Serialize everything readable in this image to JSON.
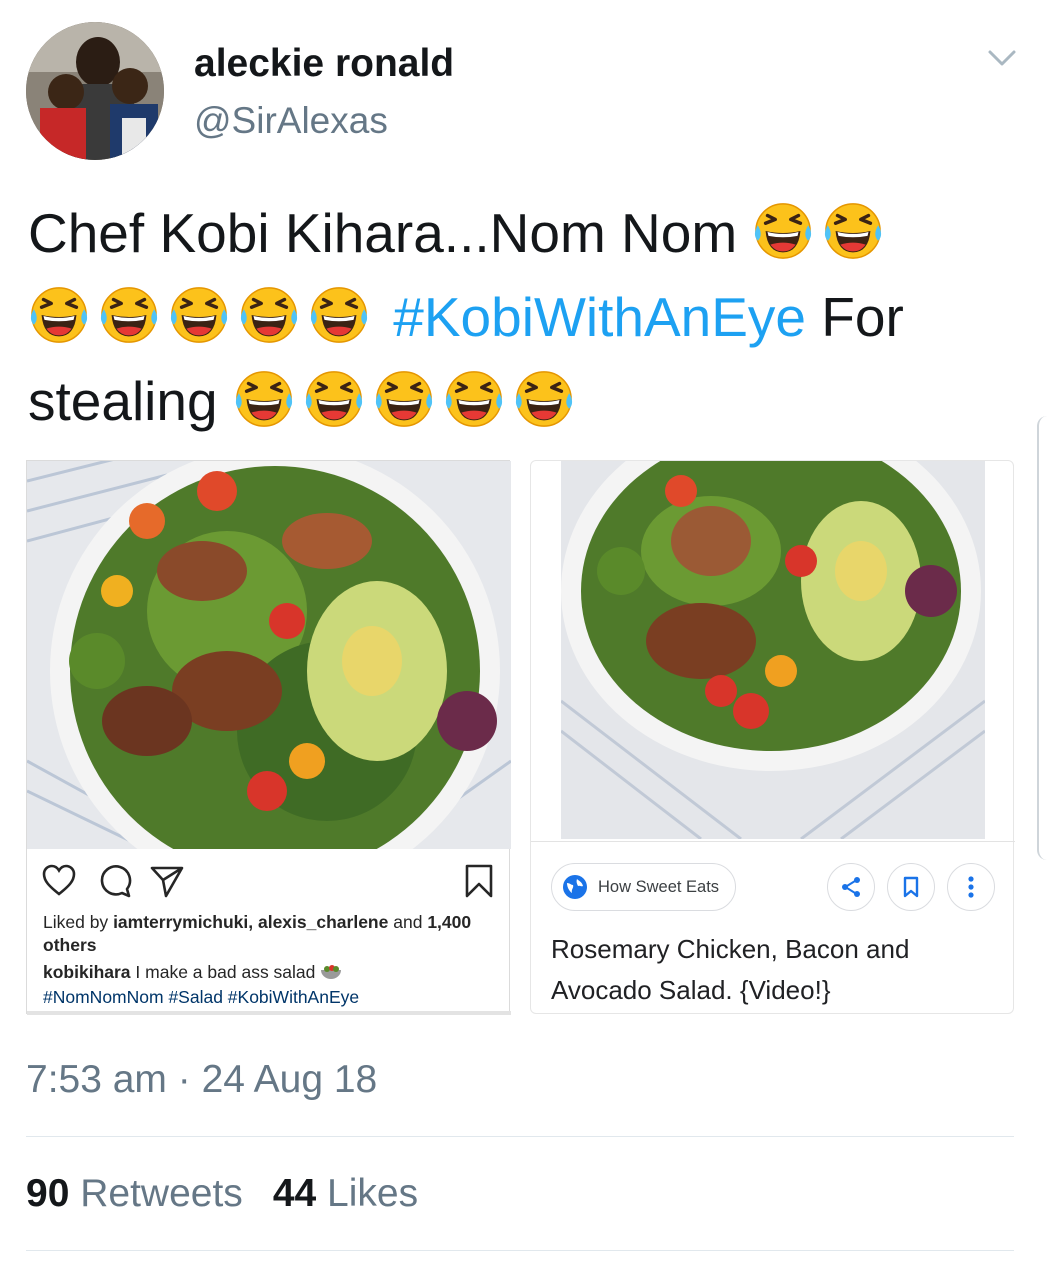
{
  "tweet": {
    "display_name": "aleckie ronald",
    "handle": "@SirAlexas",
    "text_part1": "Chef Kobi Kihara...Nom Nom",
    "hashtag": "#KobiWithAnEye",
    "text_part2": "For",
    "text_part3": "stealing",
    "emoji": "rolling-on-the-floor-laughing-emoji",
    "timestamp": "7:53 am · 24 Aug 18",
    "retweets_count": "90",
    "retweets_label": "Retweets",
    "likes_count": "44",
    "likes_label": "Likes"
  },
  "instagram_card": {
    "liked_by_prefix": "Liked by",
    "liked_by_users": "iamterrymichuki, alexis_charlene",
    "liked_by_and": "and",
    "liked_by_count": "1,400",
    "liked_by_suffix": "others",
    "caption_user": "kobikihara",
    "caption_text": "I make a bad ass salad",
    "caption_hashtags": "#NomNomNom #Salad #KobiWithAnEye",
    "icons": [
      "heart-icon",
      "comment-icon",
      "share-icon",
      "bookmark-icon"
    ]
  },
  "google_card": {
    "source": "How Sweet Eats",
    "title": "Rosemary Chicken, Bacon and Avocado Salad. {Video!}",
    "icons": [
      "globe-icon",
      "share-icon",
      "bookmark-icon",
      "more-vertical-icon"
    ],
    "accent_color": "#1a73e8"
  },
  "colors": {
    "hashtag": "#1da1f2",
    "secondary_text": "#657786",
    "primary_text": "#14171a"
  }
}
